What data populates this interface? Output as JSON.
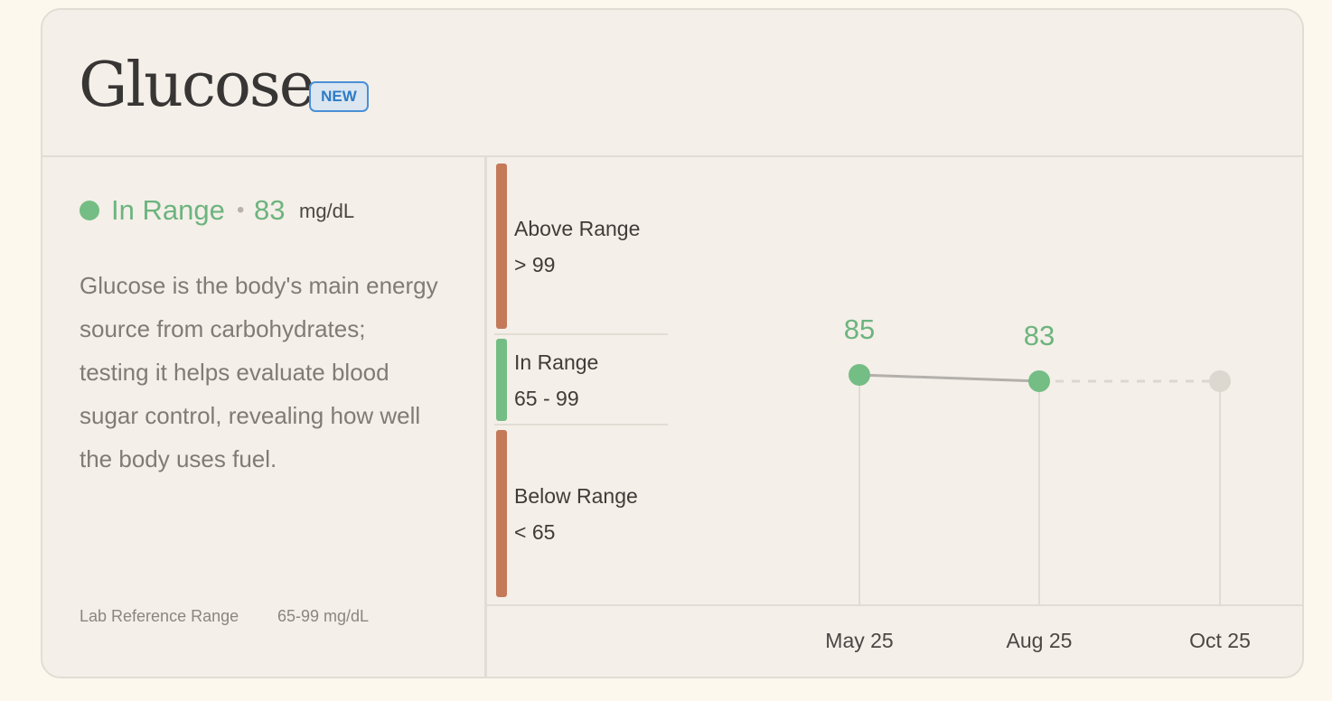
{
  "header": {
    "title": "Glucose",
    "badge": "NEW"
  },
  "status": {
    "label": "In Range",
    "separator": "•",
    "value": "83",
    "unit": "mg/dL",
    "color": "#74bd84"
  },
  "description": "Glucose is the body's main energy source from carbohydrates; testing it helps evaluate blood sugar control, revealing how well the body uses fuel.",
  "reference": {
    "label": "Lab Reference Range",
    "value": "65-99 mg/dL"
  },
  "ranges": [
    {
      "title": "Above Range",
      "sub": "> 99",
      "color": "#c47a59"
    },
    {
      "title": "In Range",
      "sub": "65 - 99",
      "color": "#74bd84"
    },
    {
      "title": "Below Range",
      "sub": "< 65",
      "color": "#c47a59"
    }
  ],
  "chart_data": {
    "type": "line",
    "x": [
      "May 25",
      "Aug 25",
      "Oct 25"
    ],
    "y": [
      85,
      83,
      null
    ],
    "data_labels": [
      "85",
      "83",
      ""
    ],
    "point_color": "#74bd84",
    "line_color": "#b3b0ac",
    "pending_color": "#dcd8d0",
    "grid": false
  }
}
